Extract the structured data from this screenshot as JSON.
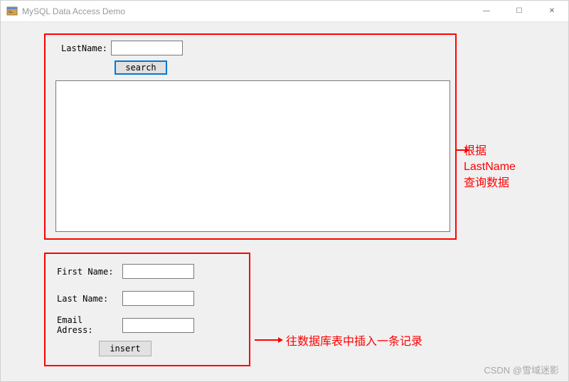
{
  "window": {
    "title": "MySQL Data Access Demo"
  },
  "titlebar": {
    "minimize": "—",
    "maximize": "☐",
    "close": "✕"
  },
  "search": {
    "lastname_label": "LastName:",
    "lastname_value": "",
    "button_label": "search"
  },
  "insert": {
    "firstname_label": "First Name:",
    "firstname_value": "",
    "lastname_label": "Last Name:",
    "lastname_value": "",
    "email_label": "Email Adress:",
    "email_value": "",
    "button_label": "insert"
  },
  "annotations": {
    "search_note": "根据\nLastName\n查询数据",
    "insert_note": "往数据库表中插入一条记录"
  },
  "watermark": "CSDN @雪域迷影"
}
